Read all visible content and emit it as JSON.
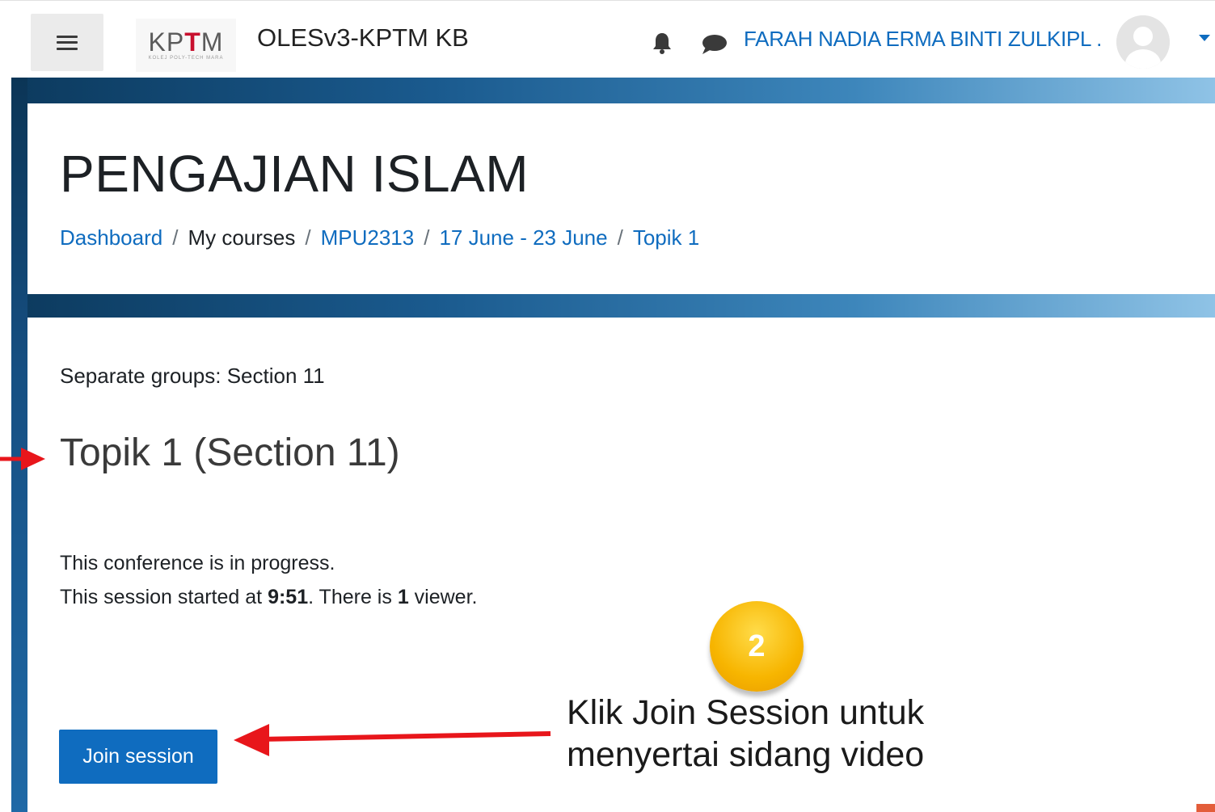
{
  "navbar": {
    "site_name": "OLESv3-KPTM KB",
    "logo_text": "KPTM",
    "logo_subtext": "KOLEJ POLY-TECH MARA",
    "user_name": "FARAH NADIA ERMA BINTI ZULKIPL .",
    "icons": [
      "hamburger-icon",
      "bell-icon",
      "chat-icon",
      "avatar",
      "caret-down-icon"
    ]
  },
  "header": {
    "title": "PENGAJIAN ISLAM",
    "breadcrumb": {
      "dashboard": "Dashboard",
      "sep": "/",
      "my_courses": "My courses",
      "course": "MPU2313",
      "week": "17 June - 23 June",
      "topic": "Topik 1"
    }
  },
  "main": {
    "groups": "Separate groups: Section 11",
    "title": "Topik 1 (Section 11)",
    "status_line1": "This conference is in progress.",
    "status_prefix": "This session started at ",
    "start_time": "9:51",
    "status_mid": ". There is ",
    "viewer_count": "1",
    "status_suffix": " viewer.",
    "join_button": "Join session"
  },
  "annotation": {
    "step_number": "2",
    "instruction_line1": "Klik Join Session untuk",
    "instruction_line2": "menyertai sidang video",
    "arrow_color": "#e8161b",
    "badge_color": "#f7b500"
  },
  "colors": {
    "link": "#0f6cbf",
    "primary_button": "#0f6cbf",
    "text": "#1d2125"
  }
}
